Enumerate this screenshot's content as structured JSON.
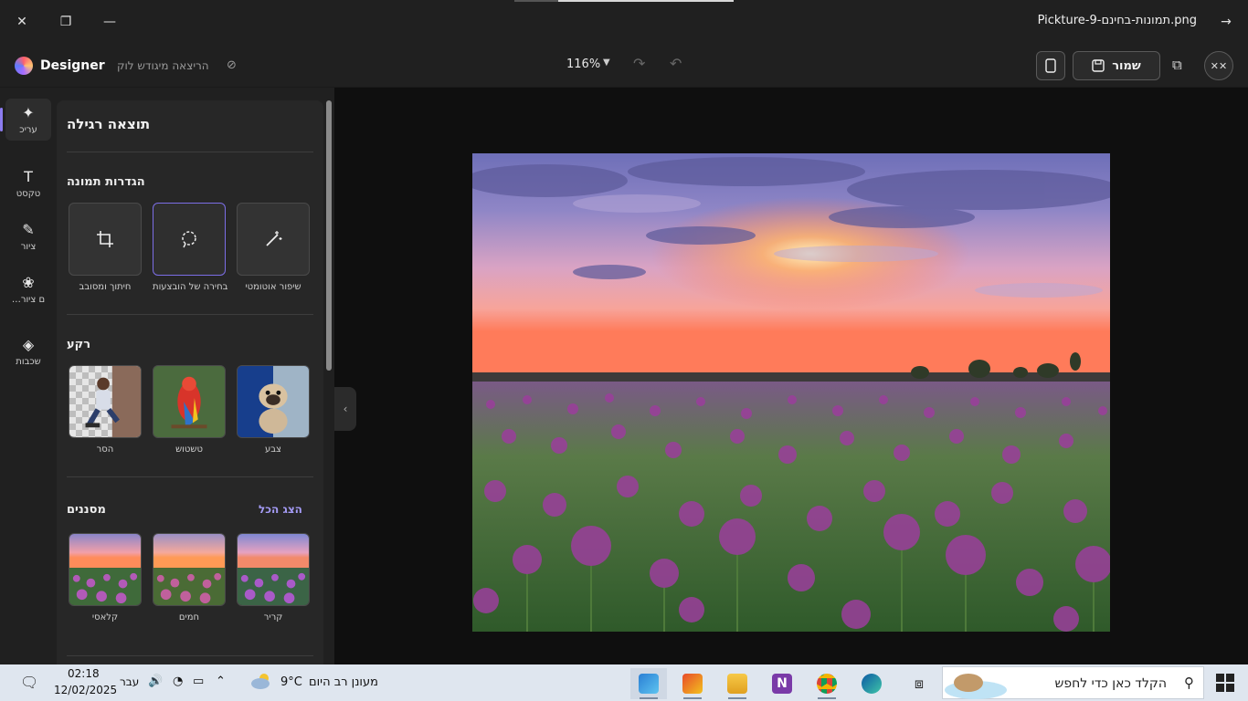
{
  "window": {
    "title": "Pickture-9-תמונות-בחינם.png",
    "close_symbol": "✕",
    "restore_symbol": "❐",
    "minimize_symbol": "—",
    "back_symbol": "→"
  },
  "toolbar": {
    "brand": "Designer",
    "cloud_status": "הריצאה מיגודש לוק",
    "zoom": "116%",
    "save_label": "שמור",
    "close_label": "✕✕"
  },
  "rail": {
    "items": [
      {
        "icon": "sparkle-icon",
        "glyph": "✦",
        "label": "עריכ"
      },
      {
        "icon": "text-icon",
        "glyph": "T",
        "label": "טקסט"
      },
      {
        "icon": "pen-icon",
        "glyph": "✎",
        "label": "ציור"
      },
      {
        "icon": "stickers-icon",
        "glyph": "❀",
        "label": "…ם ציור"
      },
      {
        "icon": "layers-icon",
        "glyph": "◈",
        "label": "שכבות"
      }
    ]
  },
  "panel": {
    "title": "תוצאה רגילה",
    "section_tools": "הגדרות תמונה",
    "tools": [
      {
        "label": "חיתוך ומסובב",
        "glyph": "⌗"
      },
      {
        "label": "בחירה של הובצעות",
        "glyph": "◌"
      },
      {
        "label": "שיפור אוטומטי",
        "glyph": "✧"
      }
    ],
    "section_background": "רקע",
    "backgrounds": [
      {
        "label": "הסר"
      },
      {
        "label": "טשטוש"
      },
      {
        "label": "צבע"
      }
    ],
    "section_filters": "מסננים",
    "see_all": "הצג הכל",
    "filters": [
      {
        "label": "קלאסי"
      },
      {
        "label": "חמים"
      },
      {
        "label": "קריר"
      }
    ]
  },
  "taskbar": {
    "time": "02:18",
    "date": "12/02/2025",
    "language": "עבר",
    "weather_temp": "9°C",
    "weather_text": "מעונן רב היום",
    "search_placeholder": "הקלד כאן כדי לחפש"
  }
}
